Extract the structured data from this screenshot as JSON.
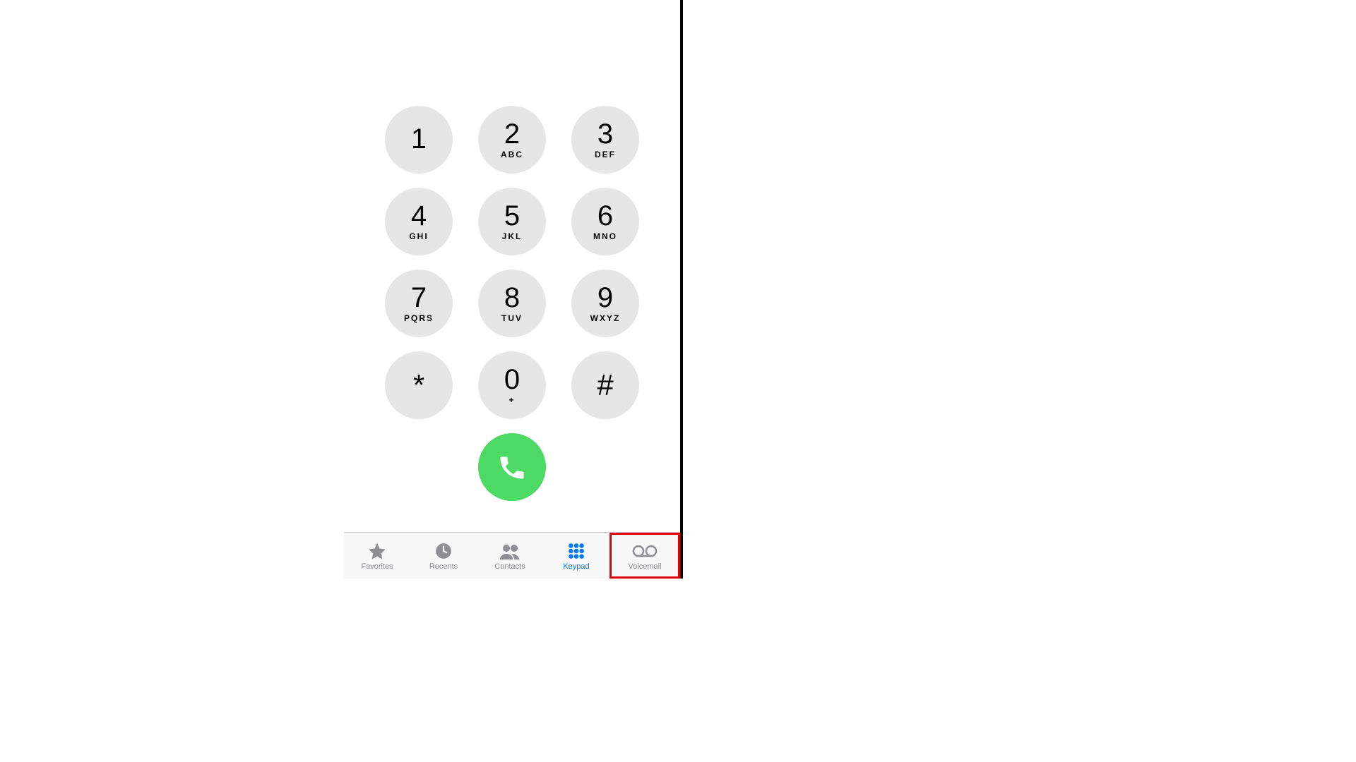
{
  "keypad": {
    "keys": [
      {
        "digit": "1",
        "letters": ""
      },
      {
        "digit": "2",
        "letters": "ABC"
      },
      {
        "digit": "3",
        "letters": "DEF"
      },
      {
        "digit": "4",
        "letters": "GHI"
      },
      {
        "digit": "5",
        "letters": "JKL"
      },
      {
        "digit": "6",
        "letters": "MNO"
      },
      {
        "digit": "7",
        "letters": "PQRS"
      },
      {
        "digit": "8",
        "letters": "TUV"
      },
      {
        "digit": "9",
        "letters": "WXYZ"
      },
      {
        "digit": "*",
        "letters": ""
      },
      {
        "digit": "0",
        "letters": "+"
      },
      {
        "digit": "#",
        "letters": ""
      }
    ]
  },
  "tabs": {
    "favorites": "Favorites",
    "recents": "Recents",
    "contacts": "Contacts",
    "keypad": "Keypad",
    "voicemail": "Voicemail",
    "active": "keypad",
    "highlighted": "voicemail"
  },
  "colors": {
    "call_green": "#4cd964",
    "active_blue": "#007aff",
    "inactive_gray": "#8e8e93",
    "highlight_red": "#e30000"
  }
}
